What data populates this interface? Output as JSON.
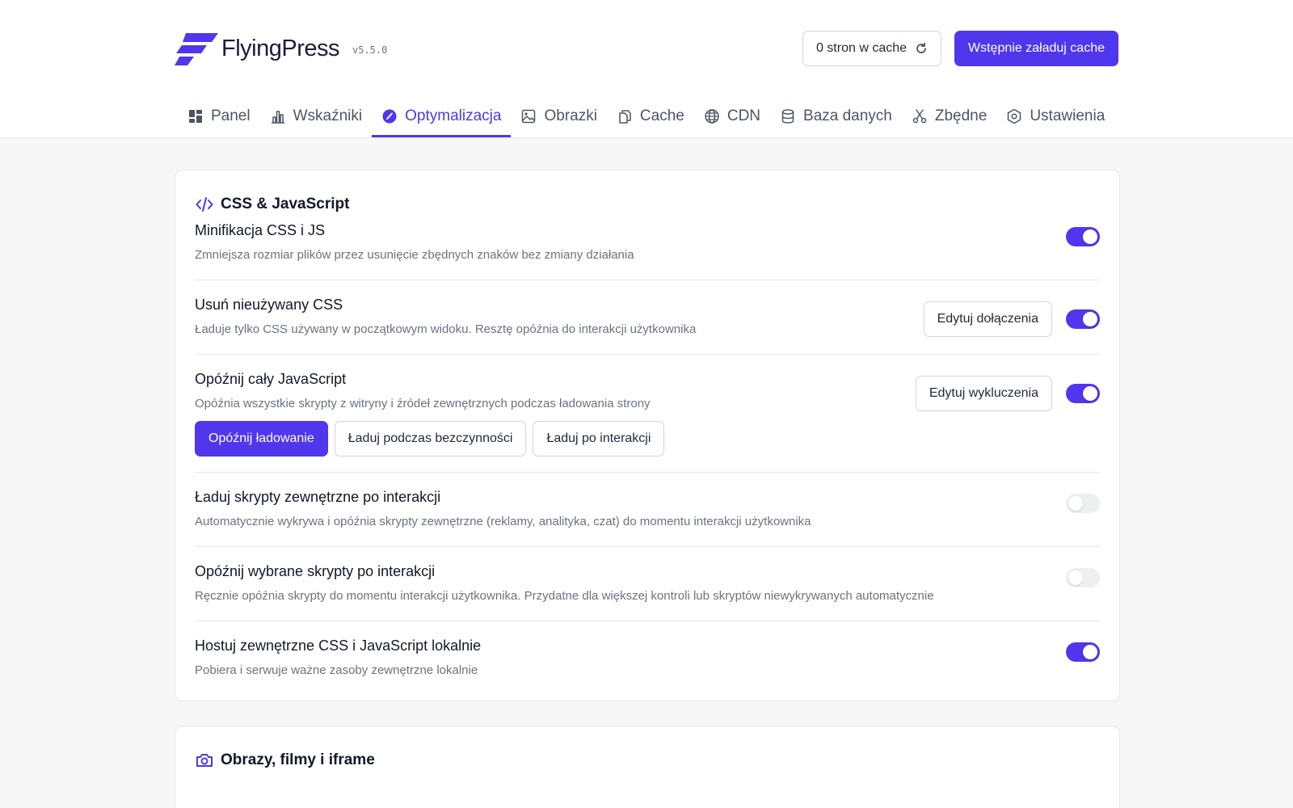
{
  "brand": {
    "name": "FlyingPress",
    "version": "v5.5.0",
    "accent_color": "#5036ec"
  },
  "header": {
    "cache_count_label": "0 stron w cache",
    "preload_label": "Wstępnie załaduj cache"
  },
  "tabs": [
    {
      "label": "Panel",
      "icon": "dashboard-icon"
    },
    {
      "label": "Wskaźniki",
      "icon": "bar-chart-icon"
    },
    {
      "label": "Optymalizacja",
      "icon": "gauge-icon",
      "active": true
    },
    {
      "label": "Obrazki",
      "icon": "image-icon"
    },
    {
      "label": "Cache",
      "icon": "copy-icon"
    },
    {
      "label": "CDN",
      "icon": "globe-icon"
    },
    {
      "label": "Baza danych",
      "icon": "database-icon"
    },
    {
      "label": "Zbędne",
      "icon": "scissors-icon"
    },
    {
      "label": "Ustawienia",
      "icon": "settings-icon"
    }
  ],
  "sections": {
    "css_js": {
      "title": "CSS & JavaScript",
      "settings": [
        {
          "title": "Minifikacja CSS i JS",
          "description": "Zmniejsza rozmiar plików przez usunięcie zbędnych znaków bez zmiany działania",
          "enabled": true
        },
        {
          "title": "Usuń nieużywany CSS",
          "description": "Ładuje tylko CSS używany w początkowym widoku. Resztę opóźnia do interakcji użytkownika",
          "button_label": "Edytuj dołączenia",
          "enabled": true
        },
        {
          "title": "Opóźnij cały JavaScript",
          "description": "Opóźnia wszystkie skrypty z witryny i źródeł zewnętrznych podczas ładowania strony",
          "button_label": "Edytuj wykluczenia",
          "enabled": true,
          "modes": [
            "Opóźnij ładowanie",
            "Ładuj podczas bezczynności",
            "Ładuj po interakcji"
          ],
          "selected_mode": "Opóźnij ładowanie"
        },
        {
          "title": "Ładuj skrypty zewnętrzne po interakcji",
          "description": "Automatycznie wykrywa i opóźnia skrypty zewnętrzne (reklamy, analityka, czat) do momentu interakcji użytkownika",
          "enabled": false
        },
        {
          "title": "Opóźnij wybrane skrypty po interakcji",
          "description": "Ręcznie opóźnia skrypty do momentu interakcji użytkownika. Przydatne dla większej kontroli lub skryptów niewykrywanych automatycznie",
          "enabled": false
        },
        {
          "title": "Hostuj zewnętrzne CSS i JavaScript lokalnie",
          "description": "Pobiera i serwuje ważne zasoby zewnętrzne lokalnie",
          "enabled": true
        }
      ]
    },
    "media": {
      "title": "Obrazy, filmy i iframe"
    }
  }
}
